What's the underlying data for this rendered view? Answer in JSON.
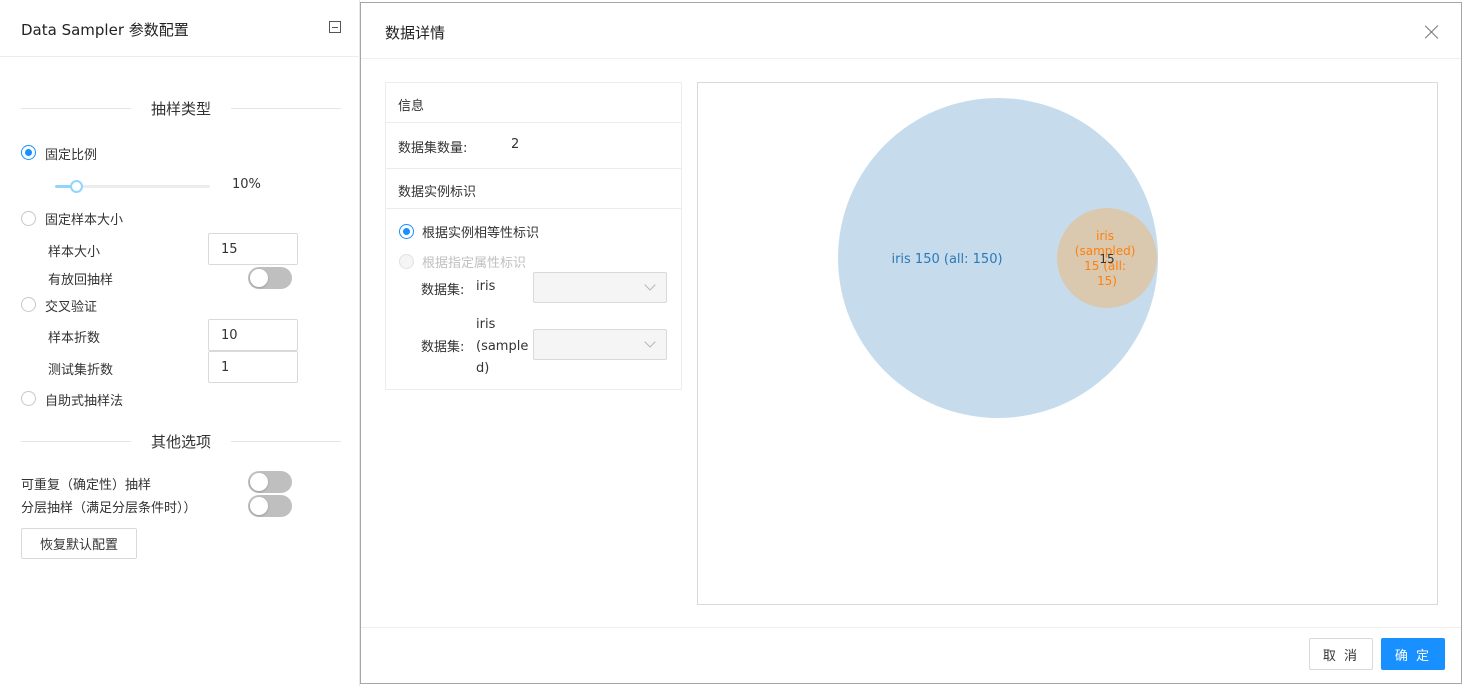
{
  "left_panel": {
    "title": "Data Sampler 参数配置",
    "sampling_type_heading": "抽样类型",
    "fixed_ratio": {
      "label": "固定比例",
      "selected": true,
      "value_text": "10%",
      "value_fraction": 0.1
    },
    "fixed_size": {
      "label": "固定样本大小",
      "selected": false,
      "sample_size_label": "样本大小",
      "sample_size_value": "15",
      "replacement_label": "有放回抽样",
      "replacement_on": false
    },
    "cross_validation": {
      "label": "交叉验证",
      "selected": false,
      "folds_label": "样本折数",
      "folds_value": "10",
      "test_folds_label": "测试集折数",
      "test_folds_value": "1"
    },
    "bootstrap": {
      "label": "自助式抽样法",
      "selected": false
    },
    "other_heading": "其他选项",
    "replicable_label": "可重复（确定性）抽样",
    "replicable_on": false,
    "stratified_label": "分层抽样（满足分层条件时））",
    "stratified_on": false,
    "reset_button": "恢复默认配置"
  },
  "modal": {
    "title": "数据详情",
    "info": {
      "heading": "信息",
      "dataset_count_label": "数据集数量:",
      "dataset_count_value": "2",
      "instance_heading": "数据实例标识",
      "by_equality_label": "根据实例相等性标识",
      "by_attribute_label": "根据指定属性标识",
      "dataset_label_1": "数据集:",
      "dataset_name_1": "iris",
      "dataset_label_2": "数据集:",
      "dataset_name_2_lines": [
        "iris",
        "(sample",
        "d)"
      ]
    },
    "cancel_button": "取 消",
    "ok_button": "确 定"
  },
  "venn": {
    "sets": [
      {
        "label": "iris 150 (all: 150)",
        "size": 150,
        "color": "#c6dcec",
        "text_color": "#2b79b6"
      },
      {
        "label_lines": [
          "iris",
          "(sampled)",
          "15 (all:",
          "15)"
        ],
        "size": 15,
        "color": "#dcc6a9",
        "text_color": "#ff7f0e"
      }
    ],
    "intersection": {
      "value": "15",
      "size": 15
    }
  }
}
